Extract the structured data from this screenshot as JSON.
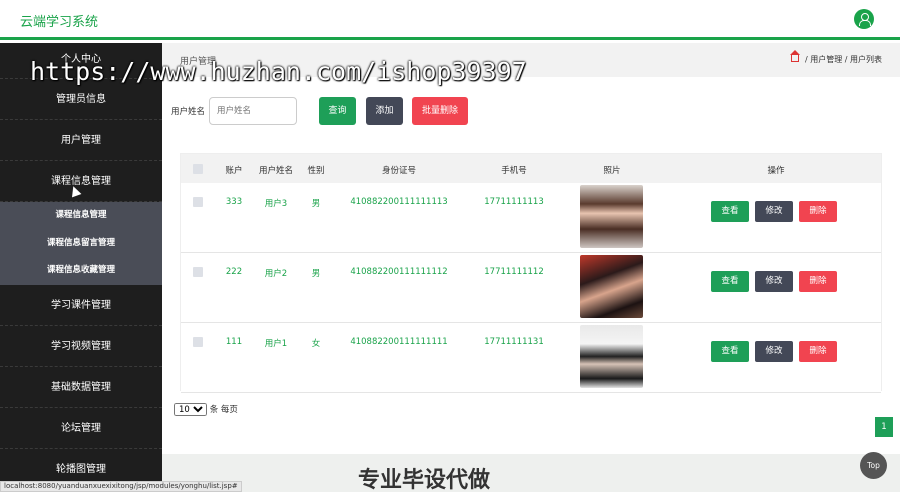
{
  "app": {
    "title": "云端学习系统"
  },
  "sidebar": {
    "items": [
      {
        "label": "个人中心"
      },
      {
        "label": "管理员信息"
      },
      {
        "label": "用户管理"
      },
      {
        "label": "课程信息管理",
        "expanded": true,
        "children": [
          {
            "label": "课程信息管理"
          },
          {
            "label": "课程信息留言管理"
          },
          {
            "label": "课程信息收藏管理"
          }
        ]
      },
      {
        "label": "学习课件管理"
      },
      {
        "label": "学习视频管理"
      },
      {
        "label": "基础数据管理"
      },
      {
        "label": "论坛管理"
      },
      {
        "label": "轮播图管理"
      }
    ]
  },
  "header": {
    "page_title": "用户管理",
    "breadcrumb": [
      "用户管理",
      "用户列表"
    ],
    "breadcrumb_sep": "/"
  },
  "search": {
    "label": "用户姓名",
    "placeholder": "用户姓名",
    "value": "",
    "query_label": "查询",
    "add_label": "添加",
    "batch_delete_label": "批量删除"
  },
  "table": {
    "columns": [
      "账户",
      "用户姓名",
      "性别",
      "身份证号",
      "手机号",
      "照片",
      "操作"
    ],
    "rows": [
      {
        "account": "333",
        "name": "用户3",
        "gender": "男",
        "id_number": "410882200111111113",
        "phone": "17711111113",
        "photo": "photo-woman-1"
      },
      {
        "account": "222",
        "name": "用户2",
        "gender": "男",
        "id_number": "410882200111111112",
        "phone": "17711111112",
        "photo": "photo-woman-2"
      },
      {
        "account": "111",
        "name": "用户1",
        "gender": "女",
        "id_number": "410882200111111111",
        "phone": "17711111131",
        "photo": "photo-woman-3"
      }
    ],
    "actions": {
      "view": "查看",
      "edit": "修改",
      "delete": "删除"
    }
  },
  "pagination": {
    "page_size": "10",
    "page_size_suffix": "条 每页",
    "current_page": "1"
  },
  "overlay": {
    "watermark": "https://www.huzhan.com/ishop39397",
    "bottom_text": "专业毕设代做"
  },
  "top_button": "Top",
  "status_url": "localhost:8080/yuanduanxuexixitong/jsp/modules/yonghu/list.jsp#",
  "colors": {
    "accent": "#1aa34a",
    "sidebar_bg": "#1e1e1e",
    "submenu_bg": "#4a4d57",
    "danger": "#f14450",
    "dark_button": "#434857"
  }
}
